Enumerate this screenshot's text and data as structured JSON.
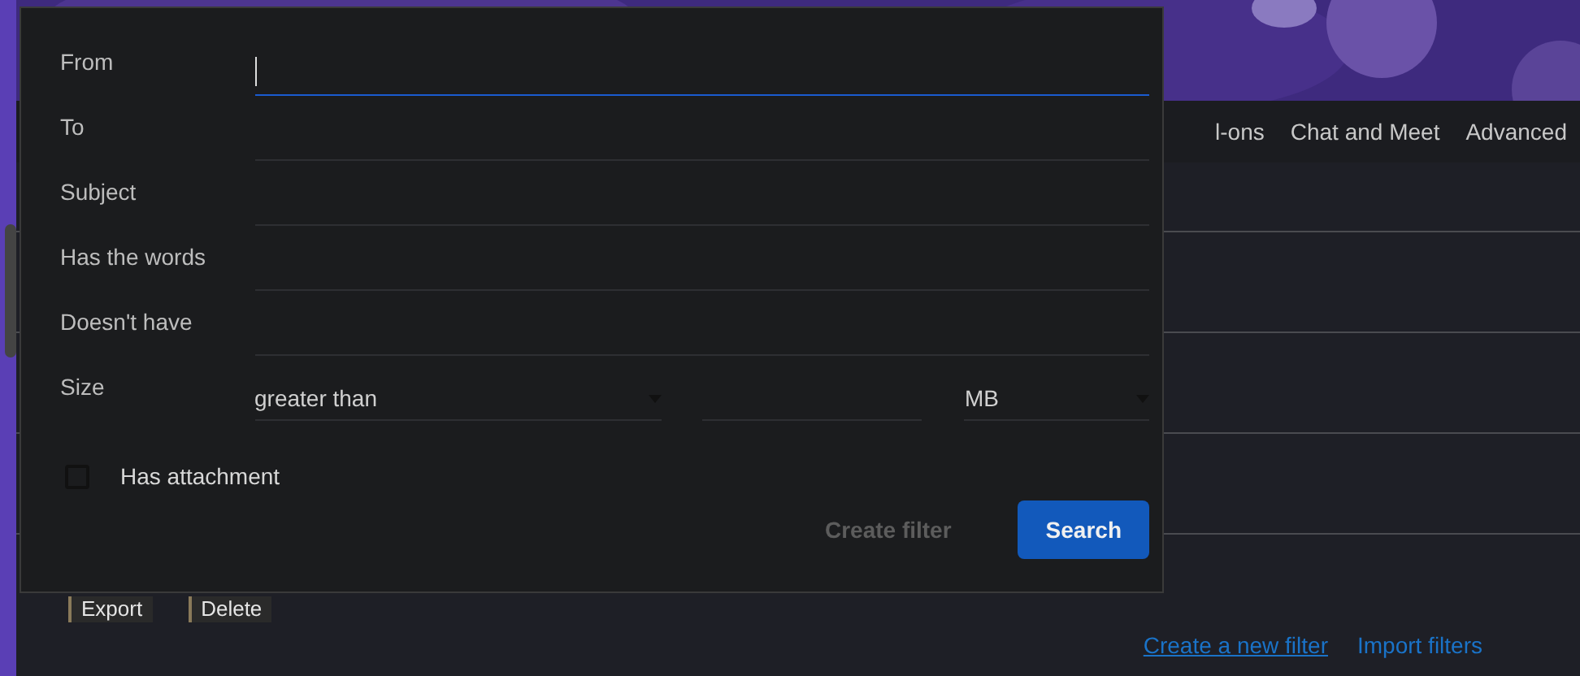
{
  "background": {
    "tabs": [
      {
        "label": "l-ons"
      },
      {
        "label": "Chat and Meet"
      },
      {
        "label": "Advanced"
      }
    ],
    "actions": [
      "Export",
      "Delete"
    ],
    "links": [
      "Create a new filter",
      "Import filters"
    ]
  },
  "dialog": {
    "fields": [
      {
        "label": "From",
        "focused": true
      },
      {
        "label": "To",
        "focused": false
      },
      {
        "label": "Subject",
        "focused": false
      },
      {
        "label": "Has the words",
        "focused": false
      },
      {
        "label": "Doesn't have",
        "focused": false
      }
    ],
    "size": {
      "label": "Size",
      "comparison": "greater than",
      "unit": "MB"
    },
    "attachment": {
      "label": "Has attachment",
      "checked": false
    },
    "buttons": [
      {
        "label": "Create filter",
        "kind": "text",
        "disabled": true
      },
      {
        "label": "Search",
        "kind": "primary",
        "disabled": false
      }
    ]
  }
}
